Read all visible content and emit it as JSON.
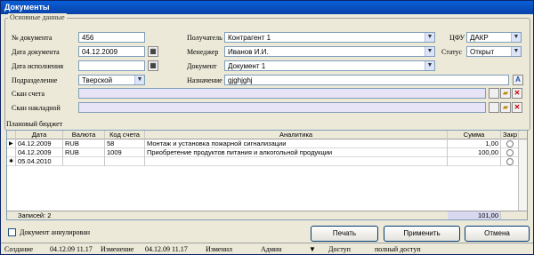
{
  "window": {
    "title": "Документы"
  },
  "main_group": {
    "title": "Основные данные"
  },
  "fields": {
    "doc_number": {
      "label": "№ документа",
      "value": "456"
    },
    "doc_date": {
      "label": "Дата документа",
      "value": "04.12.2009"
    },
    "exec_date": {
      "label": "Дата исполнения",
      "value": ""
    },
    "division": {
      "label": "Подразделение",
      "value": "Тверской"
    },
    "recipient": {
      "label": "Получатель",
      "value": "Контрагент 1"
    },
    "manager": {
      "label": "Менеджер",
      "value": "Иванов И.И."
    },
    "document": {
      "label": "Документ",
      "value": "Документ 1"
    },
    "purpose": {
      "label": "Назначение",
      "value": "gjghjghj"
    },
    "cfu": {
      "label": "ЦФУ",
      "value": "ДАКР"
    },
    "status": {
      "label": "Статус",
      "value": "Открыт"
    },
    "invoice_scan": {
      "label": "Скан счета",
      "value": ""
    },
    "waybill_scan": {
      "label": "Скан накладной",
      "value": ""
    }
  },
  "icons": {
    "calendar": "calendar-icon",
    "folder": "folder-open-icon",
    "delete": "delete-x-icon",
    "text": "text-a-icon"
  },
  "budget": {
    "title": "Плановый бюджет",
    "columns": [
      "Дата",
      "Валюта",
      "Код счета",
      "Аналитика",
      "Сумма",
      "Закр"
    ],
    "rows": [
      {
        "marker": "▶",
        "date": "04.12.2009",
        "currency": "RUB",
        "code": "58",
        "analytics": "Монтаж и установка пожарной сигнализации",
        "sum": "1,00"
      },
      {
        "marker": "",
        "date": "04.12.2009",
        "currency": "RUB",
        "code": "1009",
        "analytics": "Приобретение продуктов питания и алкогольной продукции",
        "sum": "100,00"
      },
      {
        "marker": "✱",
        "date": "05.04.2010",
        "currency": "",
        "code": "",
        "analytics": "",
        "sum": ""
      }
    ],
    "records_label": "Записей: 2",
    "total": "101,00"
  },
  "cancelled_checkbox": {
    "label": "Документ аннулирован",
    "checked": false
  },
  "buttons": {
    "print": "Печать",
    "apply": "Применить",
    "cancel": "Отмена"
  },
  "statusbar": {
    "created_label": "Создание",
    "created_value": "04.12.09 11.17",
    "changed_label": "Изменение",
    "changed_value": "04.12.09 11.17",
    "changer_label": "Изменил",
    "changer_value": "Админ",
    "access_label": "Доступ",
    "access_value": "полный доступ"
  },
  "colors": {
    "title_bar": "#0a4fc4",
    "scan_fields": "#e8e4f8",
    "window_bg": "#ece9d8"
  }
}
